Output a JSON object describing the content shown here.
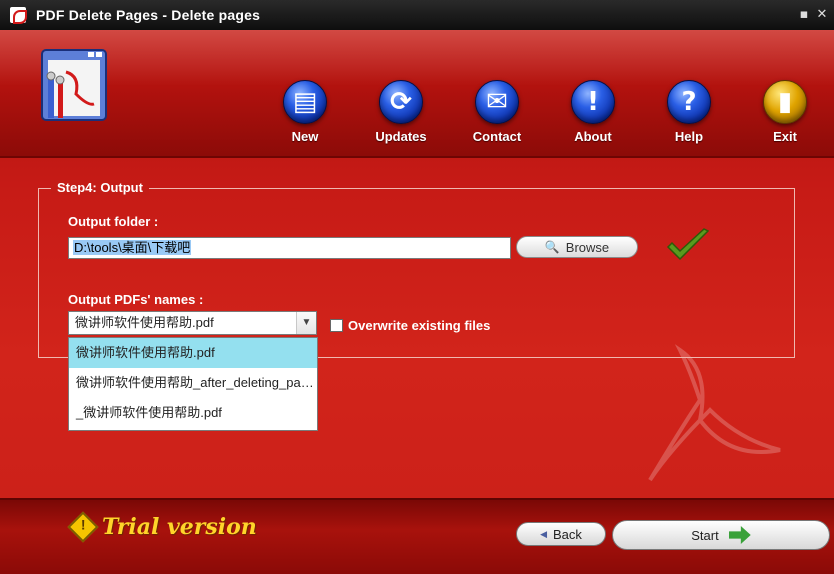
{
  "window": {
    "title": "PDF Delete Pages - Delete pages",
    "minimize_glyph": "▪",
    "close_glyph": "✕"
  },
  "toolbar": {
    "items": [
      {
        "label": "New",
        "icon": "new-icon",
        "glyph": "▤"
      },
      {
        "label": "Updates",
        "icon": "updates-icon",
        "glyph": "⟳"
      },
      {
        "label": "Contact",
        "icon": "contact-icon",
        "glyph": "✉"
      },
      {
        "label": "About",
        "icon": "about-icon",
        "glyph": "!"
      },
      {
        "label": "Help",
        "icon": "help-icon",
        "glyph": "?"
      },
      {
        "label": "Exit",
        "icon": "exit-icon",
        "glyph": "▮"
      }
    ]
  },
  "step": {
    "title": "Step4: Output",
    "output_folder_label": "Output folder :",
    "output_folder_value": "D:\\tools\\桌面\\下载吧",
    "browse_label": "Browse",
    "names_label": "Output PDFs' names :",
    "names_selected": "微讲师软件使用帮助.pdf",
    "names_options": [
      "微讲师软件使用帮助.pdf",
      "微讲师软件使用帮助_after_deleting_page...",
      "_微讲师软件使用帮助.pdf"
    ],
    "overwrite_label": "Overwrite existing files",
    "overwrite_checked": false
  },
  "footer": {
    "trial_text": "Trial version",
    "back_label": "Back",
    "start_label": "Start"
  },
  "colors": {
    "accent": "#c41c16",
    "toolbar_orb": "#1e4fd0",
    "trial": "#ffd42a",
    "ok_check": "#5a9a1e"
  }
}
